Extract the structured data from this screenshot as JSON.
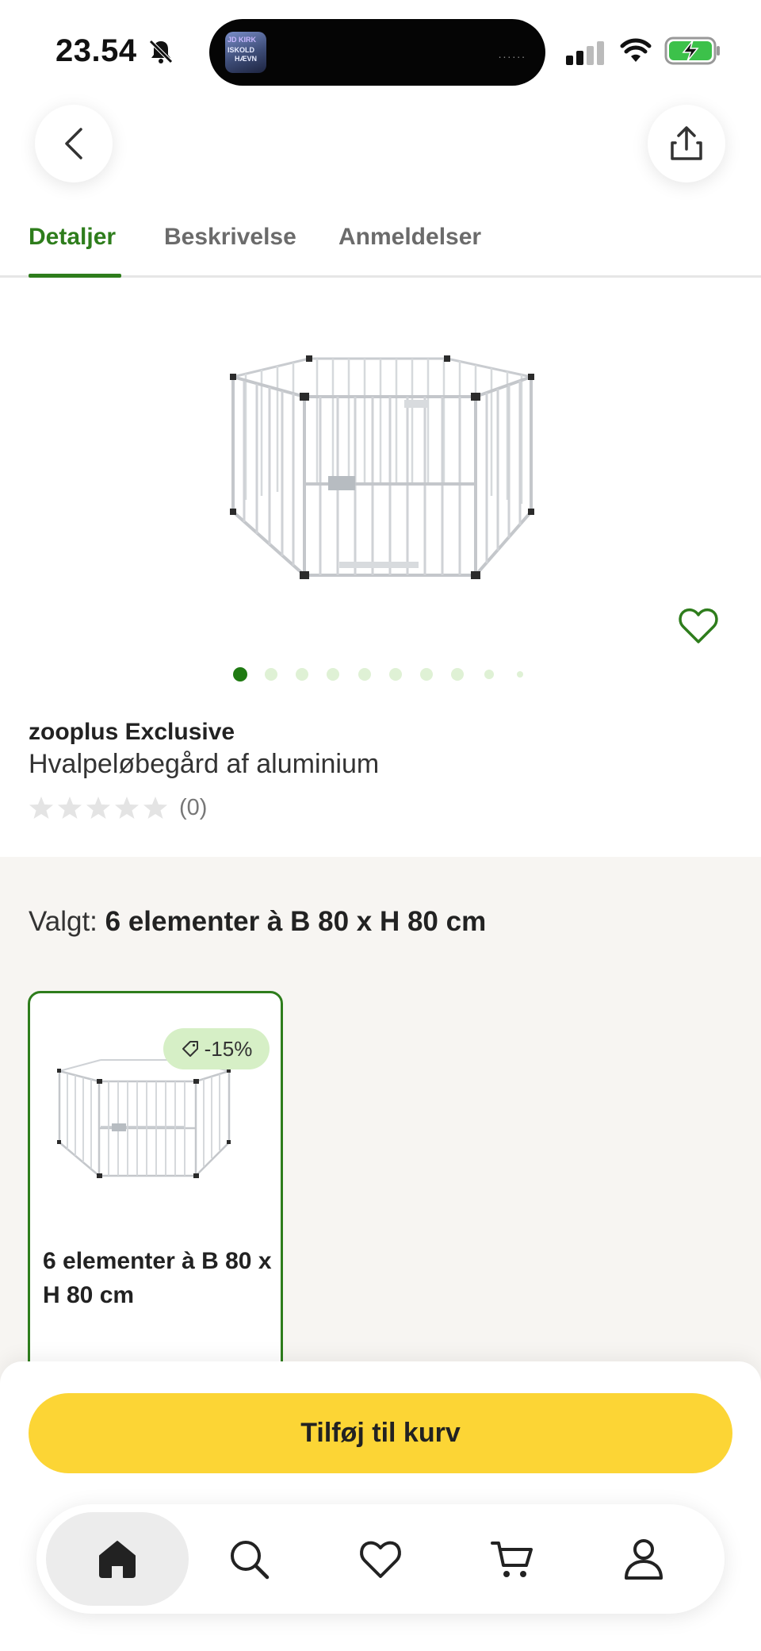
{
  "status_bar": {
    "time": "23.54",
    "now_playing_art_text": [
      "JD KIRK",
      "ISKOLD",
      "HÆVN"
    ],
    "island_indicator": "......"
  },
  "tabs": [
    {
      "label": "Detaljer",
      "active": true
    },
    {
      "label": "Beskrivelse",
      "active": false
    },
    {
      "label": "Anmeldelser",
      "active": false
    }
  ],
  "product": {
    "brand": "zooplus Exclusive",
    "name": "Hvalpeløbegård af aluminium",
    "rating_stars": 0,
    "rating_count": "(0)",
    "image_count": 10,
    "current_image": 1
  },
  "variant": {
    "selected_prefix": "Valgt: ",
    "selected_value": "6 elementer à B 80 x H 80 cm",
    "options": [
      {
        "title": "6 elementer à B 80 x H 80 cm",
        "discount": "-15%",
        "selected": true
      }
    ]
  },
  "actions": {
    "add_to_cart": "Tilføj til kurv"
  },
  "bottom_nav": [
    {
      "icon": "home-icon",
      "active": true
    },
    {
      "icon": "search-icon",
      "active": false
    },
    {
      "icon": "heart-icon",
      "active": false
    },
    {
      "icon": "cart-icon",
      "active": false
    },
    {
      "icon": "profile-icon",
      "active": false
    }
  ],
  "colors": {
    "accent_green": "#2e7d1c",
    "cta_yellow": "#fcd535",
    "discount_bg": "#d6efc6"
  }
}
